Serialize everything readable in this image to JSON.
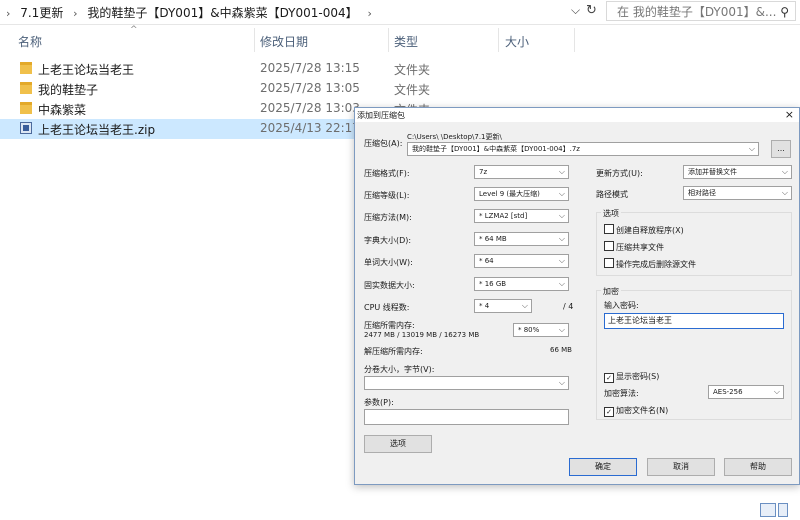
{
  "address": {
    "crumbs": [
      "›",
      "7.1更新",
      "›",
      "我的鞋垫子【DY001】&中森紫菜【DY001-004】",
      "›"
    ],
    "search_placeholder": "在 我的鞋垫子【DY001】&..."
  },
  "columns": {
    "name": "名称",
    "date": "修改日期",
    "type": "类型",
    "size": "大小"
  },
  "files": [
    {
      "name": "上老王论坛当老王",
      "date": "2025/7/28 13:15",
      "type": "文件夹",
      "icon": "folder-icon"
    },
    {
      "name": "我的鞋垫子",
      "date": "2025/7/28 13:05",
      "type": "文件夹",
      "icon": "folder-icon"
    },
    {
      "name": "中森紫菜",
      "date": "2025/7/28 13:03",
      "type": "文件夹",
      "icon": "folder-icon"
    },
    {
      "name": "上老王论坛当老王.zip",
      "date": "2025/4/13 22:17",
      "type": "",
      "icon": "zip-icon"
    }
  ],
  "dialog": {
    "title": "添加到压缩包",
    "archive_label": "压缩包(A):",
    "archive_path": "C:\\Users\\        \\Desktop\\7.1更新\\",
    "archive_name": "我的鞋垫子【DY001】&中森紫菜【DY001-004】.7z",
    "browse": "...",
    "format_label": "压缩格式(F):",
    "format": "7z",
    "level_label": "压缩等级(L):",
    "level": "Level 9 (最大压缩)",
    "method_label": "压缩方法(M):",
    "method": "* LZMA2 [std]",
    "dict_label": "字典大小(D):",
    "dict": "* 64 MB",
    "word_label": "单词大小(W):",
    "word": "* 64",
    "solid_label": "固实数据大小:",
    "solid": "* 16 GB",
    "cpu_label": "CPU 线程数:",
    "cpu": "* 4",
    "cpu_total": "/ 4",
    "mem_label": "压缩所需内存:",
    "mem_value": "2477 MB / 13019 MB / 16273 MB",
    "mem_percent": "* 80%",
    "demem_label": "解压缩所需内存:",
    "demem_value": "66 MB",
    "split_label": "分卷大小，字节(V):",
    "params_label": "参数(P):",
    "options_button": "选项",
    "update_label": "更新方式(U):",
    "update": "添加并替换文件",
    "pathmode_label": "路径模式",
    "pathmode": "相对路径",
    "options_group": "选项",
    "opt_sfx": "创建自释放程序(X)",
    "opt_shared": "压缩共享文件",
    "opt_delete": "操作完成后删除源文件",
    "enc_group": "加密",
    "pwd_label": "输入密码:",
    "pwd_value": "上老王论坛当老王",
    "show_pwd": "显示密码(S)",
    "enc_method_label": "加密算法:",
    "enc_method": "AES-256",
    "enc_names": "加密文件名(N)",
    "ok": "确定",
    "cancel": "取消",
    "help": "帮助",
    "check": "✓"
  }
}
